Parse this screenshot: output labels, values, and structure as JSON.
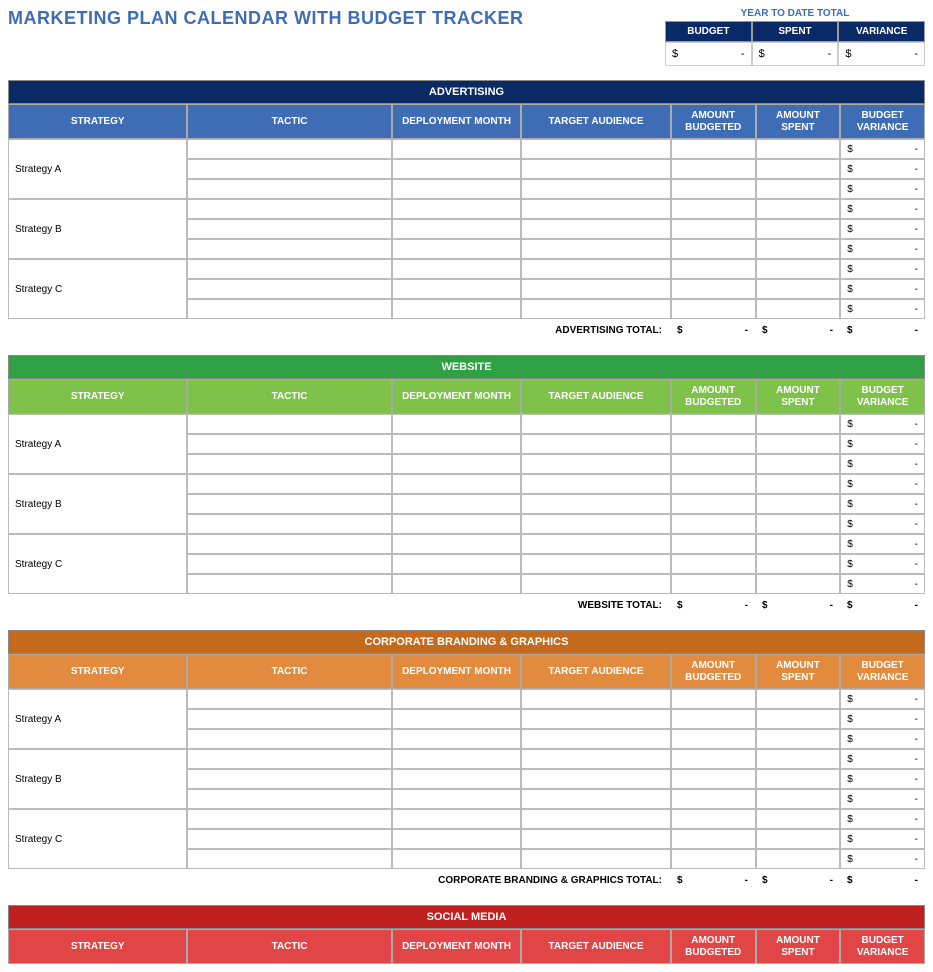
{
  "title": "MARKETING PLAN CALENDAR WITH BUDGET TRACKER",
  "ytd": {
    "title": "YEAR TO DATE TOTAL",
    "headers": [
      "BUDGET",
      "SPENT",
      "VARIANCE"
    ],
    "values": {
      "budget_sym": "$",
      "budget_val": "-",
      "spent_sym": "$",
      "spent_val": "-",
      "var_sym": "$",
      "var_val": "-"
    }
  },
  "columns": {
    "strategy": "STRATEGY",
    "tactic": "TACTIC",
    "deploy": "DEPLOYMENT MONTH",
    "target": "TARGET AUDIENCE",
    "budgeted": "AMOUNT BUDGETED",
    "spent": "AMOUNT SPENT",
    "variance": "BUDGET VARIANCE"
  },
  "money": {
    "sym": "$",
    "dash": "-"
  },
  "sections": {
    "advertising": {
      "title": "ADVERTISING",
      "total_label": "ADVERTISING TOTAL:",
      "strategies": [
        "Strategy A",
        "Strategy B",
        "Strategy C"
      ]
    },
    "website": {
      "title": "WEBSITE",
      "total_label": "WEBSITE TOTAL:",
      "strategies": [
        "Strategy A",
        "Strategy B",
        "Strategy C"
      ]
    },
    "corporate": {
      "title": "CORPORATE BRANDING & GRAPHICS",
      "total_label": "CORPORATE BRANDING & GRAPHICS TOTAL:",
      "strategies": [
        "Strategy A",
        "Strategy B",
        "Strategy C"
      ]
    },
    "social": {
      "title": "SOCIAL MEDIA"
    }
  }
}
